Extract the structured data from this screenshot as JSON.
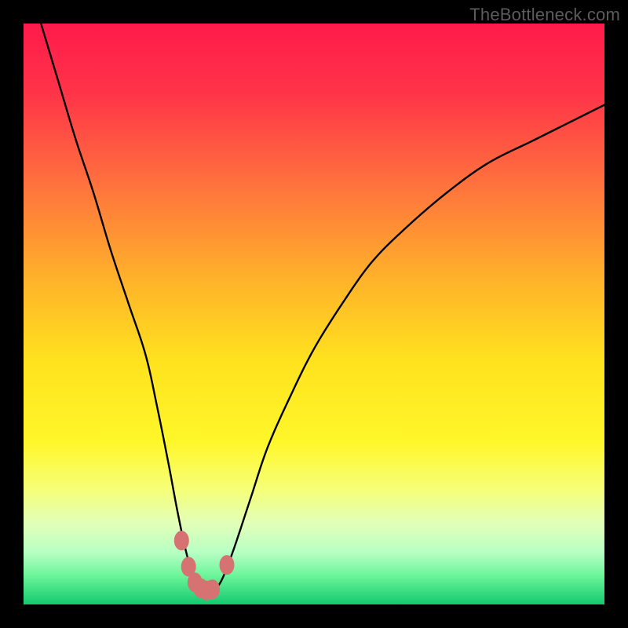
{
  "watermark": "TheBottleneck.com",
  "chart_data": {
    "type": "line",
    "title": "",
    "xlabel": "",
    "ylabel": "",
    "xlim": [
      0,
      100
    ],
    "ylim": [
      0,
      100
    ],
    "grid": false,
    "curve": {
      "x": [
        3,
        6,
        9,
        12,
        15,
        18,
        21,
        23,
        25,
        26.5,
        28,
        29.5,
        31,
        32.5,
        34,
        36,
        39,
        42,
        46,
        50,
        55,
        60,
        66,
        73,
        80,
        88,
        96,
        100
      ],
      "y": [
        100,
        90,
        80,
        71,
        61,
        52,
        43,
        34,
        24,
        16,
        9,
        4,
        2,
        2.3,
        4,
        9,
        18,
        27,
        36,
        44,
        52,
        59,
        65,
        71,
        76,
        80,
        84,
        86
      ]
    },
    "markers": [
      {
        "x": 27.2,
        "y": 11.0
      },
      {
        "x": 28.4,
        "y": 6.5
      },
      {
        "x": 29.5,
        "y": 3.8
      },
      {
        "x": 30.5,
        "y": 2.8
      },
      {
        "x": 31.5,
        "y": 2.4
      },
      {
        "x": 32.5,
        "y": 2.6
      },
      {
        "x": 35.0,
        "y": 6.8
      }
    ],
    "gradient_stops": [
      {
        "offset": 0.0,
        "color": "#ff1a4b"
      },
      {
        "offset": 0.12,
        "color": "#ff3448"
      },
      {
        "offset": 0.28,
        "color": "#ff733d"
      },
      {
        "offset": 0.44,
        "color": "#ffb22a"
      },
      {
        "offset": 0.58,
        "color": "#ffe21e"
      },
      {
        "offset": 0.72,
        "color": "#fff72a"
      },
      {
        "offset": 0.8,
        "color": "#f6ff76"
      },
      {
        "offset": 0.86,
        "color": "#e2ffb8"
      },
      {
        "offset": 0.91,
        "color": "#b8ffc4"
      },
      {
        "offset": 0.95,
        "color": "#6cf59a"
      },
      {
        "offset": 1.0,
        "color": "#14c96f"
      }
    ],
    "marker_color": "#d77272"
  }
}
